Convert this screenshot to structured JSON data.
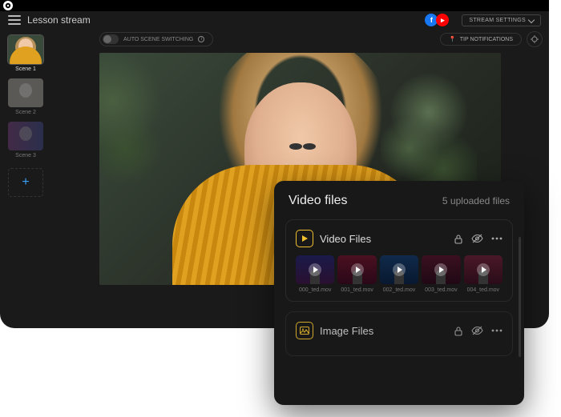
{
  "header": {
    "title": "Lesson stream",
    "settings_label": "STREAM SETTINGS"
  },
  "toolbar": {
    "auto_scene_label": "AUTO SCENE SWITCHING",
    "tip_label": "TIP NOTIFICATIONS"
  },
  "sidebar": {
    "scenes": [
      {
        "label": "Scene 1"
      },
      {
        "label": "Scene 2"
      },
      {
        "label": "Scene 3"
      }
    ]
  },
  "panel": {
    "title": "Video files",
    "subtitle": "5 uploaded files",
    "video_card": {
      "title": "Video Files",
      "items": [
        {
          "name": "000_ted.mov"
        },
        {
          "name": "001_ted.mov"
        },
        {
          "name": "002_ted.mov"
        },
        {
          "name": "003_ted.mov"
        },
        {
          "name": "004_ted.mov"
        }
      ]
    },
    "image_card": {
      "title": "Image Files"
    }
  },
  "icons": {
    "facebook": "f",
    "youtube": "▸",
    "pin": "📍",
    "add": "+"
  }
}
